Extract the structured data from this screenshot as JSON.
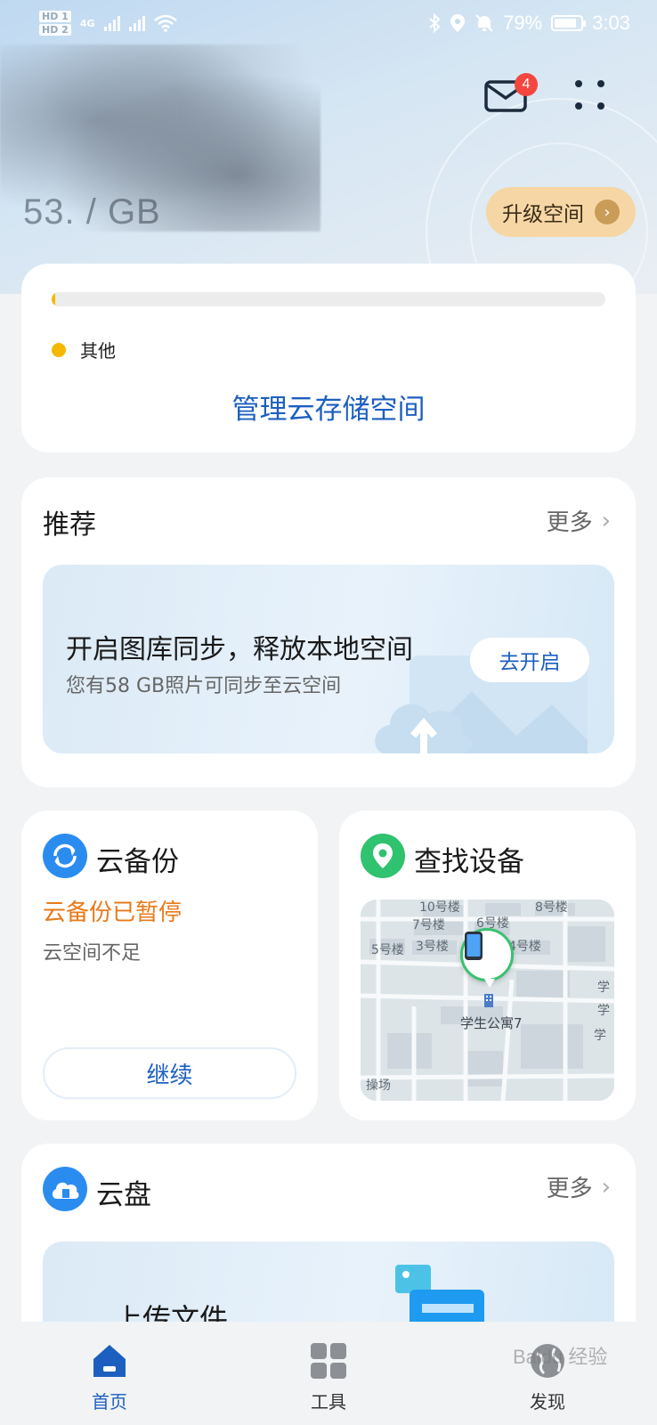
{
  "status_bar": {
    "sim1": "HD 1",
    "sim2": "HD 2",
    "network": "4G",
    "battery": "79%",
    "time": "3:03"
  },
  "header": {
    "mail_badge": "4",
    "usage": "53.  /  GB",
    "upgrade_label": "升级空间"
  },
  "storage": {
    "usage_fraction": 0.006,
    "legend_label": "其他",
    "manage_label": "管理云存储空间"
  },
  "recommend": {
    "title": "推荐",
    "more_label": "更多",
    "promo_title": "开启图库同步，释放本地空间",
    "promo_subtitle": "您有58 GB照片可同步至云空间",
    "promo_button": "去开启"
  },
  "backup": {
    "title": "云备份",
    "status": "云备份已暂停",
    "detail": "云空间不足",
    "button": "继续"
  },
  "find_device": {
    "title": "查找设备",
    "map_labels": [
      "10号楼",
      "7号楼",
      "6号楼",
      "8号楼",
      "5号楼",
      "3号楼",
      "4号楼",
      "学生公寓7",
      "操场",
      "学",
      "学",
      "学"
    ]
  },
  "drive": {
    "title": "云盘",
    "more_label": "更多",
    "banner_title": "上传文件"
  },
  "tabbar": {
    "tabs": [
      {
        "label": "首页",
        "active": true
      },
      {
        "label": "工具",
        "active": false
      },
      {
        "label": "发现",
        "active": false
      }
    ]
  },
  "watermark": "Baidu 经验",
  "colors": {
    "accent": "#1d5fbf",
    "warning": "#e87a1a",
    "legend_other": "#f5b800",
    "badge": "#f2463f"
  }
}
